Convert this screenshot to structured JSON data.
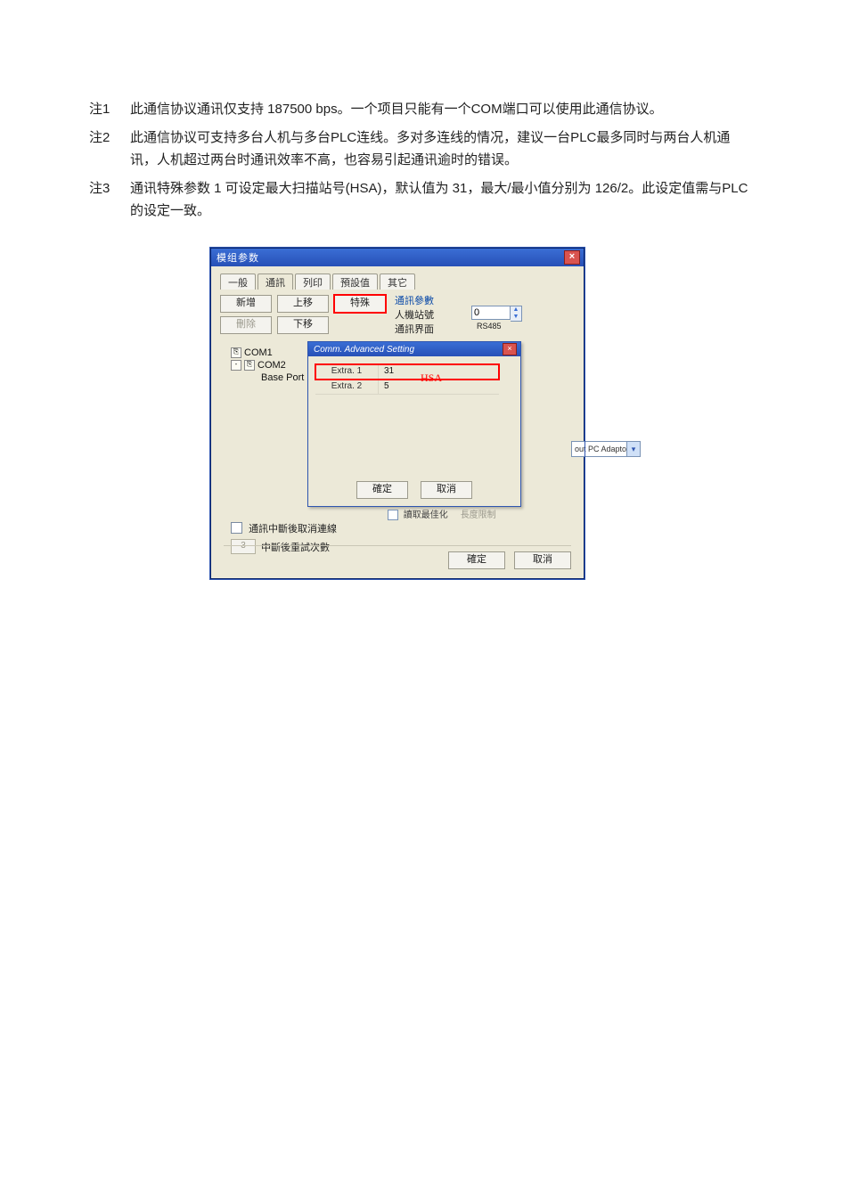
{
  "notes": [
    {
      "label": "注1",
      "text": "此通信协议通讯仅支持 187500 bps。一个项目只能有一个COM端口可以使用此通信协议。"
    },
    {
      "label": "注2",
      "text": "此通信协议可支持多台人机与多台PLC连线。多对多连线的情况，建议一台PLC最多同时与两台人机通讯，人机超过两台时通讯效率不高，也容易引起通讯逾时的错误。"
    },
    {
      "label": "注3",
      "text": "通讯特殊参数 1 可设定最大扫描站号(HSA)，默认值为 31，最大/最小值分别为 126/2。此设定值需与PLC的设定一致。"
    }
  ],
  "dialog": {
    "title": "模组参数",
    "closeGlyph": "×",
    "tabs": [
      "一般",
      "通訊",
      "列印",
      "預設值",
      "其它"
    ],
    "activeTabIndex": 1,
    "buttons": {
      "add": "新增",
      "up": "上移",
      "special": "特殊",
      "delete": "刪除",
      "down": "下移"
    },
    "params": {
      "groupLabel": "通訊參數",
      "hmiStationLabel": "人機站號",
      "hmiStationValue": "0",
      "interfaceLabel": "通訊界面",
      "interfaceValue": "RS485"
    },
    "tree": {
      "com1": "COM1",
      "com2": "COM2",
      "basePort": "Base Port"
    },
    "inner": {
      "title": "Comm. Advanced Setting",
      "rows": [
        {
          "label": "Extra. 1",
          "value": "31"
        },
        {
          "label": "Extra. 2",
          "value": "5"
        }
      ],
      "hsa": "HSA",
      "ok": "確定",
      "cancel": "取消"
    },
    "peekDropdown": "out PC Adaptor)",
    "belowInnerChecks": {
      "left": "讀取最佳化",
      "right": "長度限制"
    },
    "lowerLeft": {
      "disconnectLabel": "通訊中斷後取消連線",
      "retryCount": "3",
      "retryLabel": "中斷後重試次數"
    },
    "footer": {
      "ok": "確定",
      "cancel": "取消"
    }
  }
}
